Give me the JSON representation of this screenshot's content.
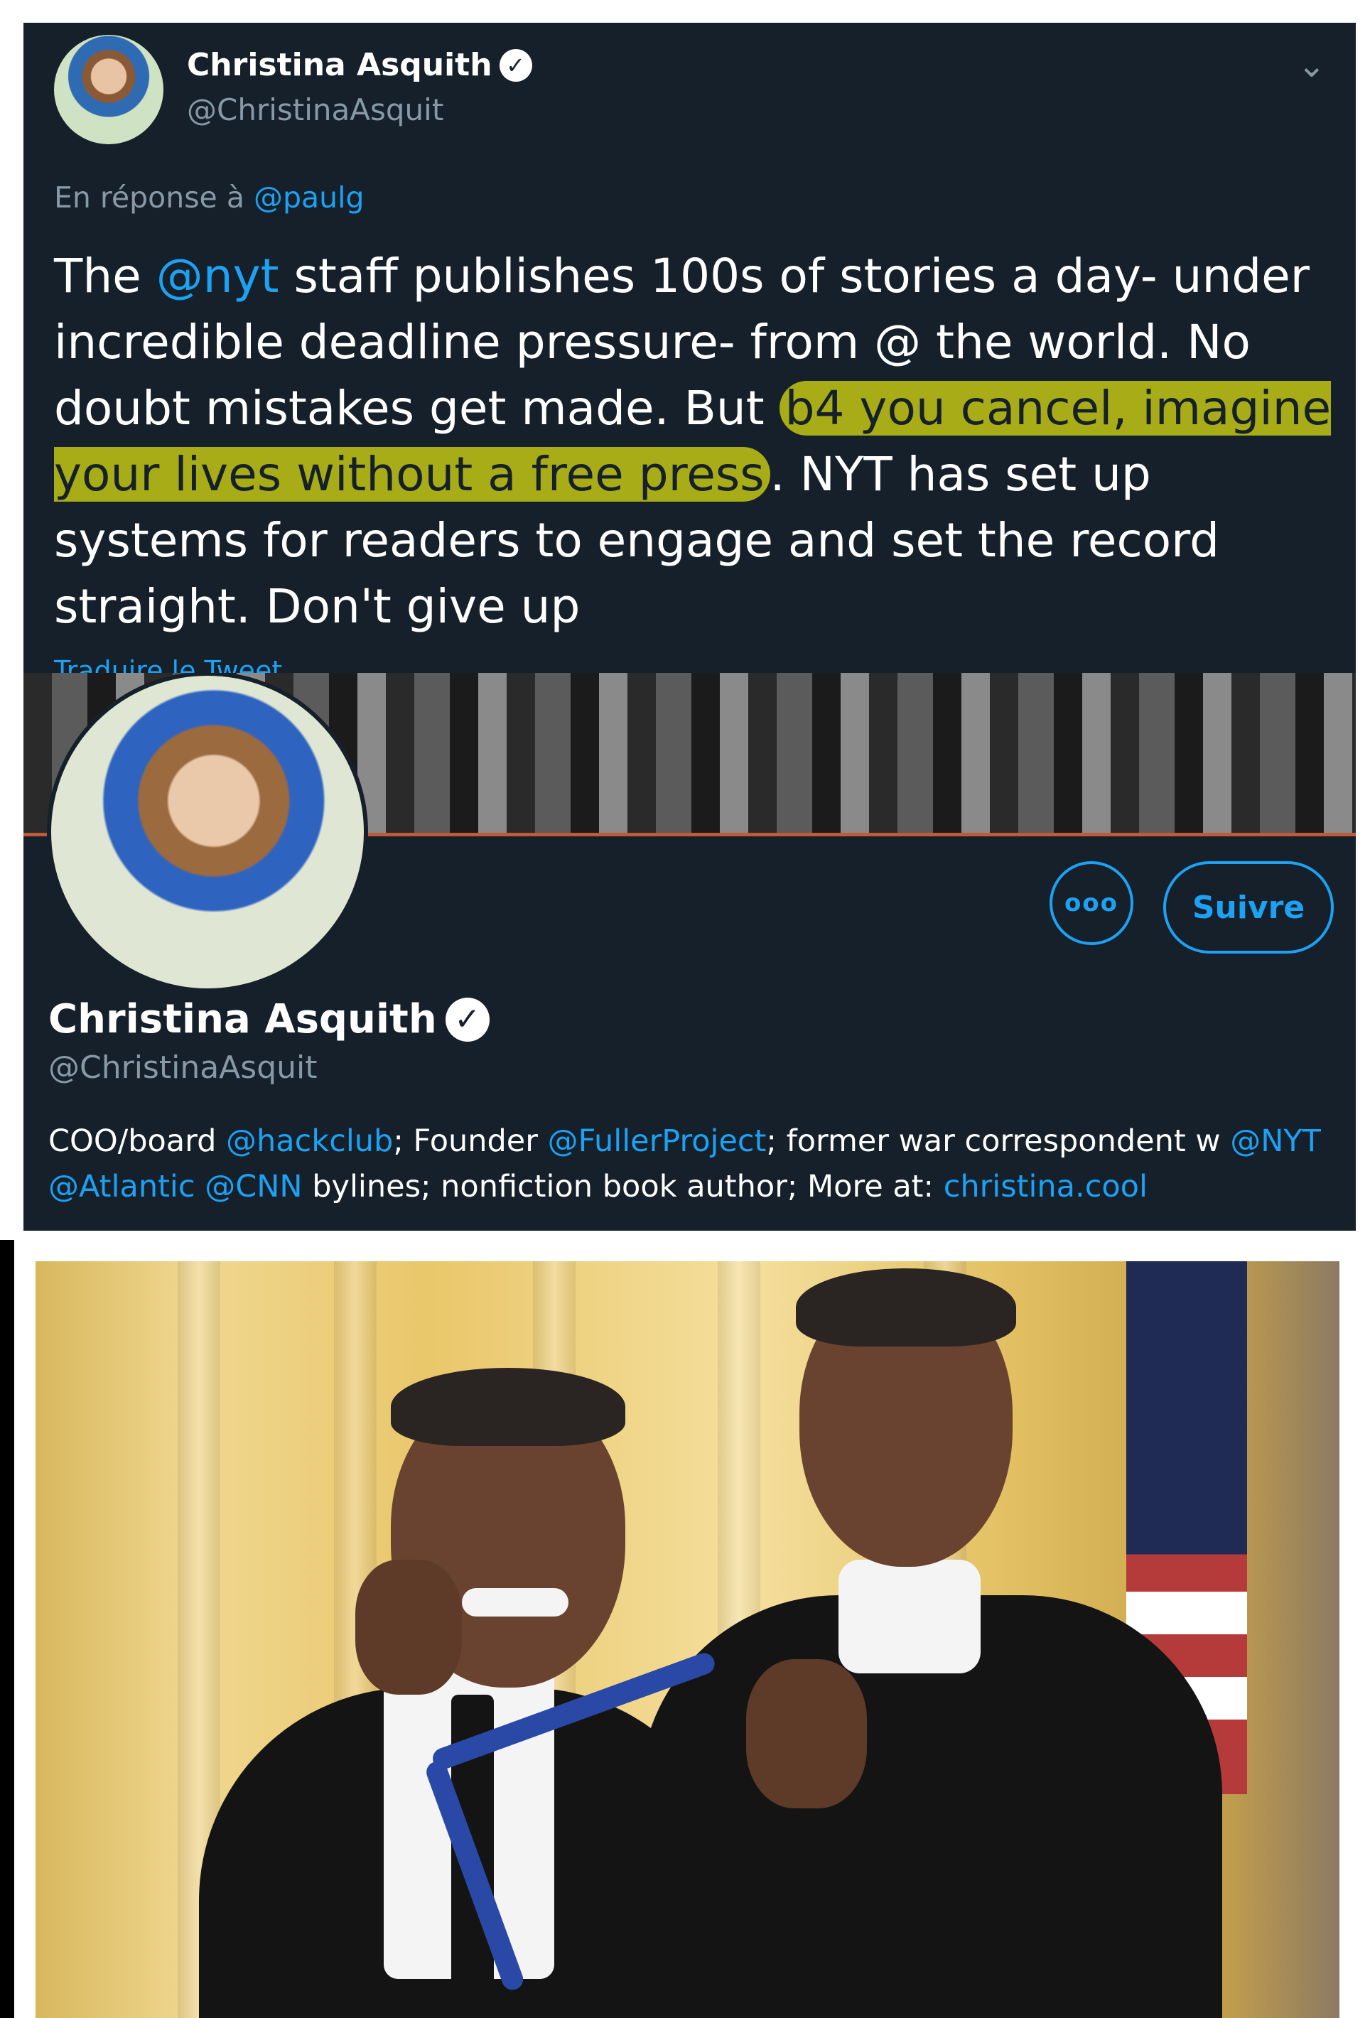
{
  "tweet": {
    "author_name": "Christina Asquith",
    "verified_glyph": "✓",
    "author_handle": "@ChristinaAsquit",
    "menu_icon": "chevron-down-icon",
    "reply_prefix": "En réponse à",
    "reply_handle": "@paulg",
    "text": {
      "part1": "The ",
      "mention": "@nyt",
      "part2": " staff publishes 100s of stories a day- under incredible deadline pressure- from @ the world. No doubt mistakes get made.  But ",
      "highlight": "b4 you cancel, imagine your lives without a free press",
      "part3": ". NYT has set up systems for readers to engage and set the record straight. Don't give up"
    },
    "highlight_color": "#a8ad17",
    "translate_label": "Traduire le Tweet"
  },
  "profile": {
    "more_label": "ooo",
    "follow_label": "Suivre",
    "name": "Christina Asquith",
    "verified_glyph": "✓",
    "handle": "@ChristinaAsquit",
    "bio": {
      "t1": "COO/board ",
      "l1": "@hackclub",
      "t2": "; Founder ",
      "l2": "@FullerProject",
      "t3": "; former war correspondent w ",
      "l3": "@NYT",
      "t4": " ",
      "l4": "@Atlantic",
      "t5": " ",
      "l5": "@CNN",
      "t6": " bylines; nonfiction book author; More at: ",
      "l6": "christina.cool"
    },
    "accent_color": "#1da1f2",
    "background_color": "#15202b"
  },
  "photo": {
    "description_icon": "meme-photo"
  }
}
